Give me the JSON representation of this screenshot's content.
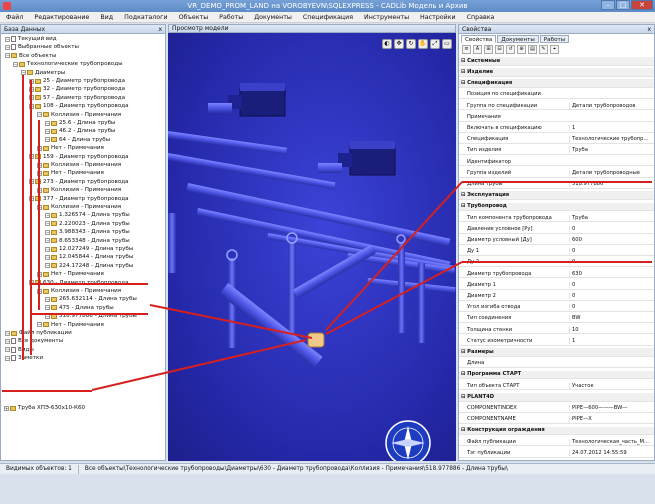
{
  "window": {
    "title": "VR_DEMO_PROM_LAND на VOROBYEVN\\SQLEXPRESS - CADLib Модель и Архив"
  },
  "menu": [
    "Файл",
    "Редактирование",
    "Вид",
    "Подкаталоги",
    "Объекты",
    "Работы",
    "Документы",
    "Спецификация",
    "Инструменты",
    "Настройки",
    "Справка"
  ],
  "tree_panel": {
    "title": "База Данных",
    "close": "x",
    "rows": [
      {
        "label": "Текущий вид",
        "indent": 0,
        "icon": "doc"
      },
      {
        "label": "Выбранные объекты",
        "indent": 0,
        "icon": "doc"
      },
      {
        "label": "Все объекты",
        "indent": 0,
        "icon": "fld"
      },
      {
        "label": "Технологические трубопроводы",
        "indent": 1,
        "icon": "fld"
      },
      {
        "label": "Диаметры",
        "indent": 2,
        "icon": "fld"
      },
      {
        "label": "25 - Диаметр трубопровода",
        "indent": 3,
        "icon": "fld"
      },
      {
        "label": "32 - Диаметр трубопровода",
        "indent": 3,
        "icon": "fld"
      },
      {
        "label": "57 - Диаметр трубопровода",
        "indent": 3,
        "icon": "fld"
      },
      {
        "label": "108 - Диаметр трубопровода",
        "indent": 3,
        "icon": "fld"
      },
      {
        "label": "Коллизия - Примечания",
        "indent": 4,
        "icon": "fld"
      },
      {
        "label": "25.6 - Длина трубы",
        "indent": 5,
        "icon": "fld"
      },
      {
        "label": "46.2 - Длина трубы",
        "indent": 5,
        "icon": "fld"
      },
      {
        "label": "64 - Длина трубы",
        "indent": 5,
        "icon": "fld"
      },
      {
        "label": "Нет - Примечания",
        "indent": 4,
        "icon": "fld"
      },
      {
        "label": "159 - Диаметр трубопровода",
        "indent": 3,
        "icon": "fld"
      },
      {
        "label": "Коллизия - Примечания",
        "indent": 4,
        "icon": "fld"
      },
      {
        "label": "Нет - Примечания",
        "indent": 4,
        "icon": "fld"
      },
      {
        "label": "273 - Диаметр трубопровода",
        "indent": 3,
        "icon": "fld"
      },
      {
        "label": "Коллизия - Примечания",
        "indent": 4,
        "icon": "fld"
      },
      {
        "label": "377 - Диаметр трубопровода",
        "indent": 3,
        "icon": "fld"
      },
      {
        "label": "Коллизия - Примечания",
        "indent": 4,
        "icon": "fld"
      },
      {
        "label": "1.326574 - Длина трубы",
        "indent": 5,
        "icon": "fld"
      },
      {
        "label": "2.220023 - Длина трубы",
        "indent": 5,
        "icon": "fld"
      },
      {
        "label": "3.988343 - Длина трубы",
        "indent": 5,
        "icon": "fld"
      },
      {
        "label": "8.653348 - Длина трубы",
        "indent": 5,
        "icon": "fld"
      },
      {
        "label": "12.027249 - Длина трубы",
        "indent": 5,
        "icon": "fld"
      },
      {
        "label": "12.045844 - Длина трубы",
        "indent": 5,
        "icon": "fld"
      },
      {
        "label": "224.17248 - Длина трубы",
        "indent": 5,
        "icon": "fld"
      },
      {
        "label": "Нет - Примечания",
        "indent": 4,
        "icon": "fld"
      },
      {
        "label": "630 - Диаметр трубопровода",
        "indent": 3,
        "icon": "fld"
      },
      {
        "label": "Коллизия - Примечания",
        "indent": 4,
        "icon": "fld"
      },
      {
        "label": "265.632114 - Длина трубы",
        "indent": 5,
        "icon": "fld"
      },
      {
        "label": "475 - Длина трубы",
        "indent": 5,
        "icon": "fld"
      },
      {
        "label": "518.977886 - Длина трубы",
        "indent": 5,
        "icon": "fld"
      },
      {
        "label": "Нет - Примечания",
        "indent": 4,
        "icon": "fld"
      },
      {
        "label": "Файл публикации",
        "indent": 0,
        "icon": "fld"
      },
      {
        "label": "Все документы",
        "indent": 0,
        "icon": "doc"
      },
      {
        "label": "Виды",
        "indent": 0,
        "icon": "doc"
      },
      {
        "label": "Заметки",
        "indent": 0,
        "icon": "doc"
      }
    ],
    "bottom_item": "Труба ХПЭ-630х10-К60"
  },
  "viewer": {
    "title": "Просмотр модели",
    "tools": [
      "◐",
      "✥",
      "↻",
      "✋",
      "⤢",
      "▭"
    ]
  },
  "props_panel": {
    "title": "Свойства",
    "tabs": [
      "Свойства",
      "Документы",
      "Работы"
    ],
    "tools": [
      "≡",
      "A",
      "⊞",
      "⊟",
      "↺",
      "⊕",
      "▤",
      "✎",
      "⌖"
    ],
    "rows": [
      {
        "cat": true,
        "k": "Системные",
        "v": ""
      },
      {
        "cat": true,
        "k": "Изделие",
        "v": ""
      },
      {
        "cat": true,
        "k": "Спецификация",
        "v": ""
      },
      {
        "k": "Позиция по спецификации",
        "v": ""
      },
      {
        "k": "Группа по спецификации",
        "v": "Детали трубопроводов"
      },
      {
        "k": "Примечания",
        "v": ""
      },
      {
        "k": "Включать в спецификацию",
        "v": "1"
      },
      {
        "k": "Спецификация",
        "v": "Технологические трубопр..."
      },
      {
        "k": "Тип изделия",
        "v": "Труба"
      },
      {
        "k": "Идентификатор",
        "v": ""
      },
      {
        "k": "Группа изделий",
        "v": "Детали трубопроводные"
      },
      {
        "k": "Длина трубы",
        "v": "518.977886"
      },
      {
        "cat": true,
        "k": "Эксплуатация",
        "v": ""
      },
      {
        "cat": true,
        "k": "Трубопровод",
        "v": ""
      },
      {
        "k": "Тип компонента трубопровода",
        "v": "Труба"
      },
      {
        "k": "Давление условное [Ру]",
        "v": "0"
      },
      {
        "k": "Диаметр условный [Ду]",
        "v": "600"
      },
      {
        "k": "Ду 1",
        "v": "0"
      },
      {
        "k": "Ду 2",
        "v": "0"
      },
      {
        "k": "Диаметр трубопровода",
        "v": "630"
      },
      {
        "k": "Диаметр 1",
        "v": "0"
      },
      {
        "k": "Диаметр 2",
        "v": "0"
      },
      {
        "k": "Угол изгиба отвода",
        "v": "0"
      },
      {
        "k": "Тип соединения",
        "v": "BW"
      },
      {
        "k": "Толщина стенки",
        "v": "10"
      },
      {
        "k": "Статус изометричности",
        "v": "1"
      },
      {
        "cat": true,
        "k": "Размеры",
        "v": ""
      },
      {
        "k": "Длина",
        "v": ""
      },
      {
        "cat": true,
        "k": "Программа СТАРТ",
        "v": ""
      },
      {
        "k": "Тип объекта СТАРТ",
        "v": "Участок"
      },
      {
        "cat": true,
        "k": "PLANT4D",
        "v": ""
      },
      {
        "k": "COMPONENTINDEX",
        "v": "PIPE—600———BW—"
      },
      {
        "k": "COMPONENTNAME",
        "v": "PIPE—X"
      },
      {
        "cat": true,
        "k": "Конструкция ограждения",
        "v": ""
      },
      {
        "k": "Файл публикации",
        "v": "Технологическая_часть_М..."
      },
      {
        "k": "Тэг публикации",
        "v": "24.07.2012 14:55:59"
      }
    ]
  },
  "status": {
    "count": "Видимых объектов: 1",
    "path": "Все объекты\\Технологические трубопроводы\\Диаметры\\630 - Диаметр трубопровода\\Коллизия - Примечания\\518.977886 - Длина трубы\\"
  },
  "colors": {
    "accent_red": "#d62020",
    "viewer_bg": "#2a2fb8",
    "pipe": "#4d55e6",
    "highlight": "#f1c98a"
  }
}
